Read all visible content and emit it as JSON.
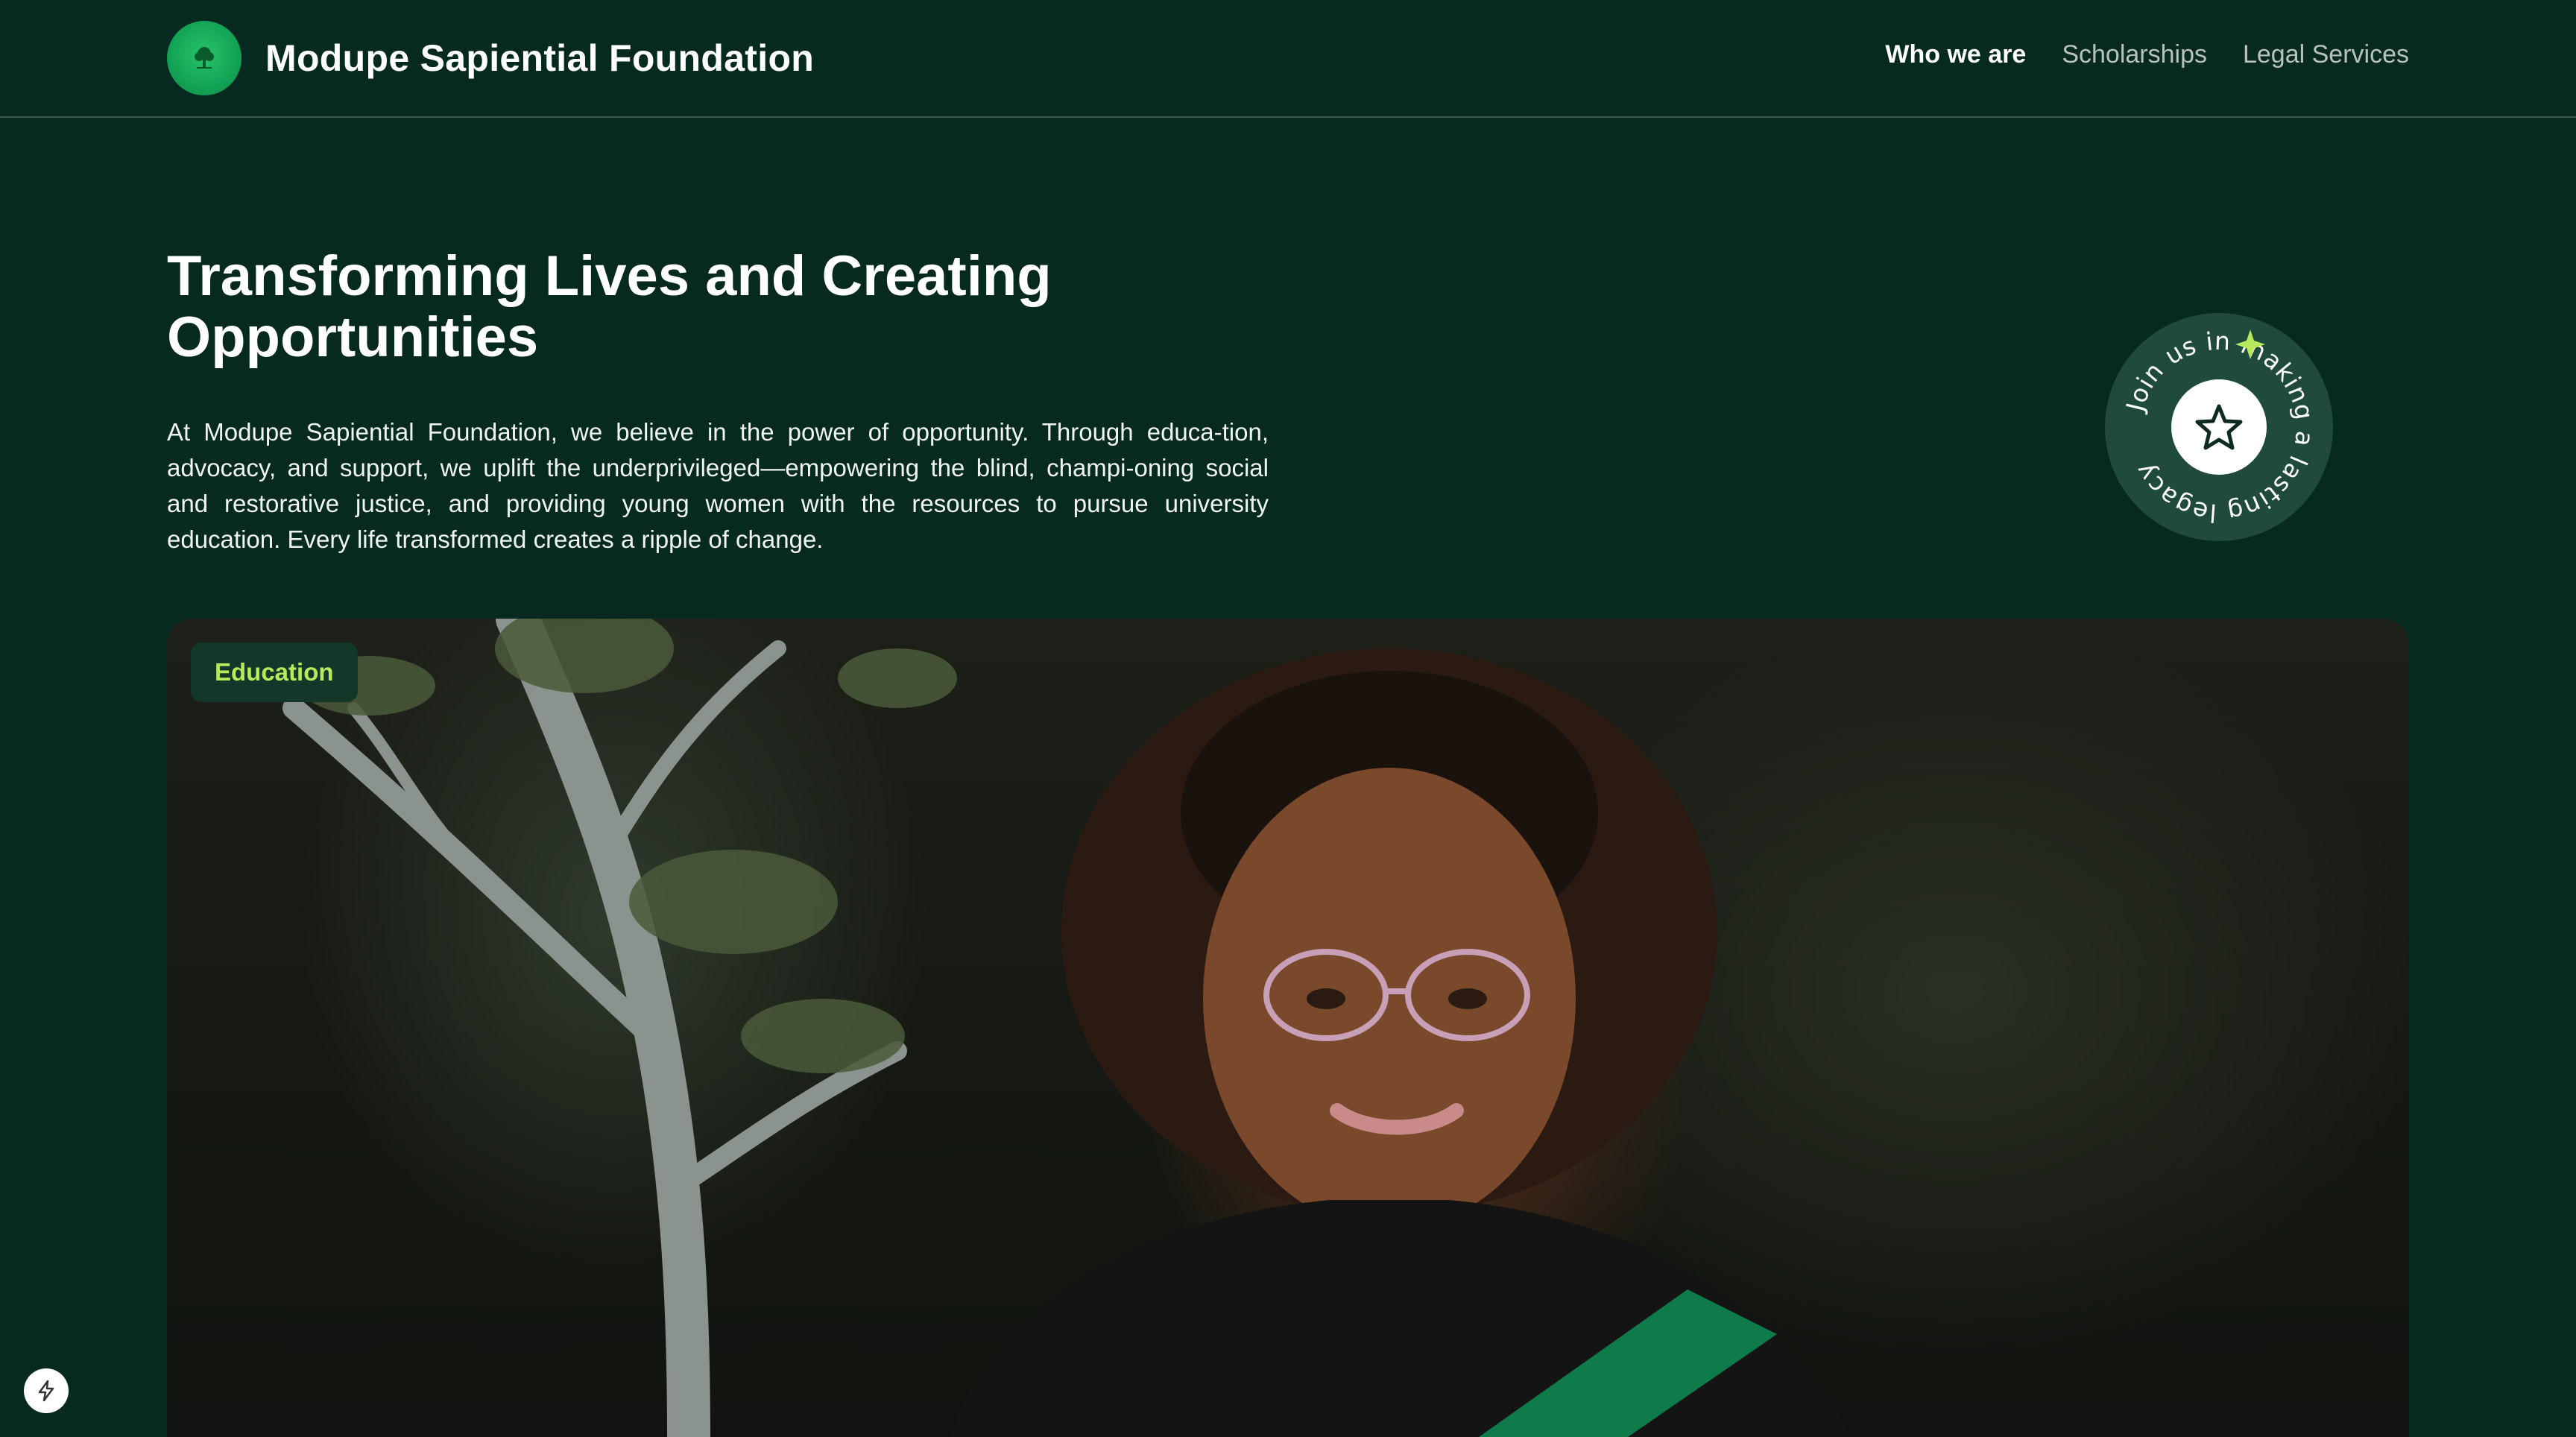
{
  "header": {
    "brand_name": "Modupe Sapiential Foundation",
    "logo_icon": "tree-logo-icon",
    "nav": [
      {
        "label": "Who we are",
        "active": true
      },
      {
        "label": "Scholarships",
        "active": false
      },
      {
        "label": "Legal Services",
        "active": false
      }
    ]
  },
  "hero": {
    "title": "Transforming Lives and Creating Opportunities",
    "body": "At Modupe Sapiential Foundation, we believe in the power of opportunity. Through educa-tion, advocacy, and support, we uplift the underprivileged—empowering the blind, champi-oning social and restorative justice, and providing young women with the resources to pursue university education. Every life transformed creates a ripple of change."
  },
  "badge": {
    "ring_text": "Join us in making a lasting legacy",
    "center_icon": "star-outline-icon",
    "accent_icon": "sparkle-icon"
  },
  "media": {
    "tag_label": "Education",
    "image_subject": "graduate-woman-photo"
  },
  "floating": {
    "icon": "lightning-bolt-icon"
  },
  "colors": {
    "background": "#062a20",
    "accent_green": "#b6ea5a",
    "logo_green": "#13a356",
    "badge_ring": "#1f4a3c"
  }
}
